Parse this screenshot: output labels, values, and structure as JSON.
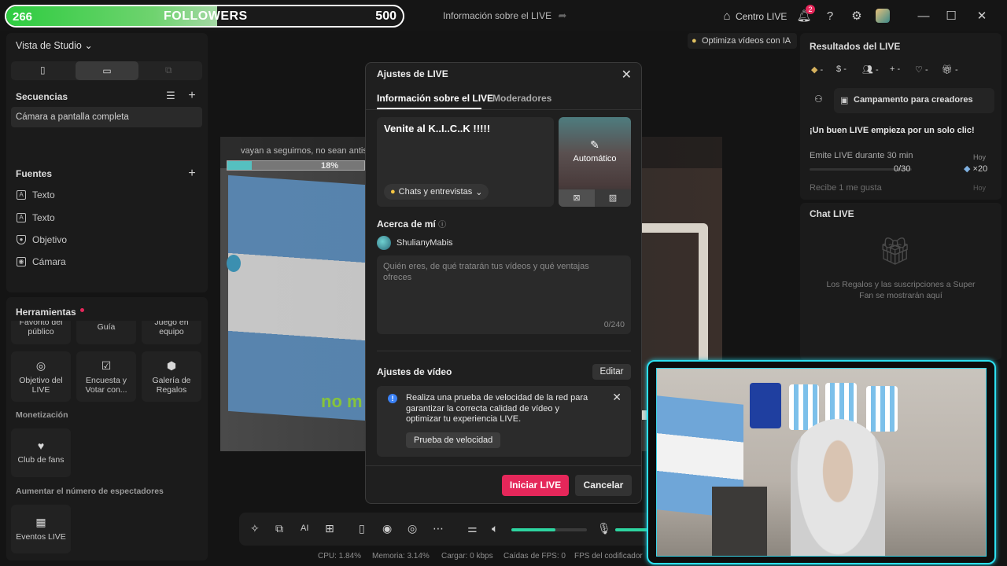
{
  "titlebar": {
    "followers": {
      "current": "266",
      "label": "FOLLOWERS",
      "goal": "500",
      "progress": 0.532
    },
    "center_title": "Información sobre el LIVE",
    "centro_live": "Centro LIVE",
    "notification_badge": "2",
    "ai_tip": "Optimiza vídeos con IA"
  },
  "left": {
    "studio_view": "Vista de Studio",
    "sequences_title": "Secuencias",
    "sequence_item": "Cámara a pantalla completa",
    "sources_title": "Fuentes",
    "sources": [
      {
        "icon": "text-icon",
        "label": "Texto"
      },
      {
        "icon": "text-icon",
        "label": "Texto"
      },
      {
        "icon": "target-icon",
        "label": "Objetivo"
      },
      {
        "icon": "camera-icon",
        "label": "Cámara"
      }
    ],
    "tools_title": "Herramientas",
    "tools_row1": [
      "Favorito del público",
      "Guía",
      "Juego en equipo"
    ],
    "tools_row2": [
      "Objetivo del LIVE",
      "Encuesta y Votar con...",
      "Galería de Regalos"
    ],
    "monetization": "Monetización",
    "fan_club": "Club de fans",
    "increase_viewers": "Aumentar el número de espectadores",
    "live_events": "Eventos LIVE"
  },
  "preview": {
    "ticker": "vayan a seguirnos, no sean antis",
    "goal_percent": "18%",
    "green_text": "no m"
  },
  "modal": {
    "title": "Ajustes de LIVE",
    "tabs": [
      "Información sobre el LIVE",
      "Moderadores"
    ],
    "live_title": "Venite al K..I..C..K !!!!!",
    "category": "Chats y entrevistas",
    "cover_label": "Automático",
    "about_me": "Acerca de mí",
    "username": "ShulianyMabis",
    "bio_placeholder": "Quién eres, de qué tratarán tus vídeos y qué ventajas ofreces",
    "bio_count": "0/240",
    "video_settings": "Ajustes de vídeo",
    "edit": "Editar",
    "notice_text": "Realiza una prueba de velocidad de la red para garantizar la correcta calidad de vídeo y optimizar tu experiencia LIVE.",
    "speed_test": "Prueba de velocidad",
    "start_live": "Iniciar LIVE",
    "cancel": "Cancelar"
  },
  "right": {
    "results_title": "Resultados del LIVE",
    "stats": [
      "-",
      "-",
      "-",
      "-",
      "-",
      "-"
    ],
    "campaign": "Campamento para creadores",
    "headline": "¡Un buen LIVE empieza por un solo clic!",
    "task1": "Emite LIVE durante 30 min",
    "task1_when": "Hoy",
    "task1_progress": "0/30",
    "task1_reward": "×20",
    "task2": "Recibe 1 me gusta",
    "task2_when": "Hoy",
    "chat_title": "Chat LIVE",
    "chat_empty": "Los Regalos y las suscripciones a Super Fan se mostrarán aquí"
  },
  "status": {
    "cpu": "CPU:  1.84%",
    "memory": "Memoria:  3.14%",
    "upload": "Cargar:  0 kbps",
    "fps_drops": "Caídas de FPS:  0",
    "encoder_fps": "FPS del codificador"
  },
  "colors": {
    "accent": "#e5275a",
    "cam_border": "#2de0f0",
    "follower_bar": "#2ecc40"
  }
}
